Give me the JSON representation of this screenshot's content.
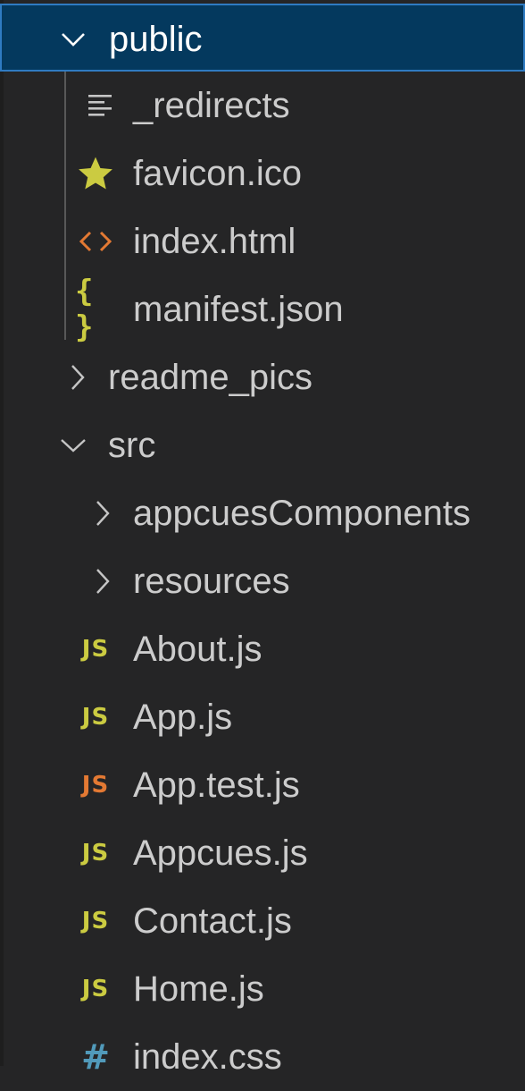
{
  "explorer": {
    "items": [
      {
        "label": "public",
        "kind": "folder-open",
        "icon": "chevron-down-icon"
      },
      {
        "label": "_redirects",
        "kind": "file",
        "icon": "text-lines-icon"
      },
      {
        "label": "favicon.ico",
        "kind": "file",
        "icon": "star-icon"
      },
      {
        "label": "index.html",
        "kind": "file",
        "icon": "html-code-icon"
      },
      {
        "label": "manifest.json",
        "kind": "file",
        "icon": "json-braces-icon"
      },
      {
        "label": "readme_pics",
        "kind": "folder-closed",
        "icon": "chevron-right-icon"
      },
      {
        "label": "src",
        "kind": "folder-open",
        "icon": "chevron-down-icon"
      },
      {
        "label": "appcuesComponents",
        "kind": "folder-closed",
        "icon": "chevron-right-icon"
      },
      {
        "label": "resources",
        "kind": "folder-closed",
        "icon": "chevron-right-icon"
      },
      {
        "label": "About.js",
        "kind": "file",
        "icon": "js-icon"
      },
      {
        "label": "App.js",
        "kind": "file",
        "icon": "js-icon"
      },
      {
        "label": "App.test.js",
        "kind": "file",
        "icon": "js-test-icon"
      },
      {
        "label": "Appcues.js",
        "kind": "file",
        "icon": "js-icon"
      },
      {
        "label": "Contact.js",
        "kind": "file",
        "icon": "js-icon"
      },
      {
        "label": "Home.js",
        "kind": "file",
        "icon": "js-icon"
      },
      {
        "label": "index.css",
        "kind": "file",
        "icon": "css-hash-icon"
      }
    ]
  },
  "icons": {
    "js_glyph": "JS",
    "json_glyph": "{ }",
    "css_glyph": "#"
  },
  "colors": {
    "background": "#252526",
    "selection_background": "#04395e",
    "selection_border": "#2f7bc2",
    "text": "#cccccc",
    "selected_text": "#ffffff",
    "chevron": "#c5c5c5",
    "js_yellow": "#cbcb41",
    "js_test_orange": "#e37933",
    "html_orange": "#e37933",
    "json_yellow": "#cbcb41",
    "star_yellow": "#cbcb41",
    "css_blue": "#519aba"
  }
}
